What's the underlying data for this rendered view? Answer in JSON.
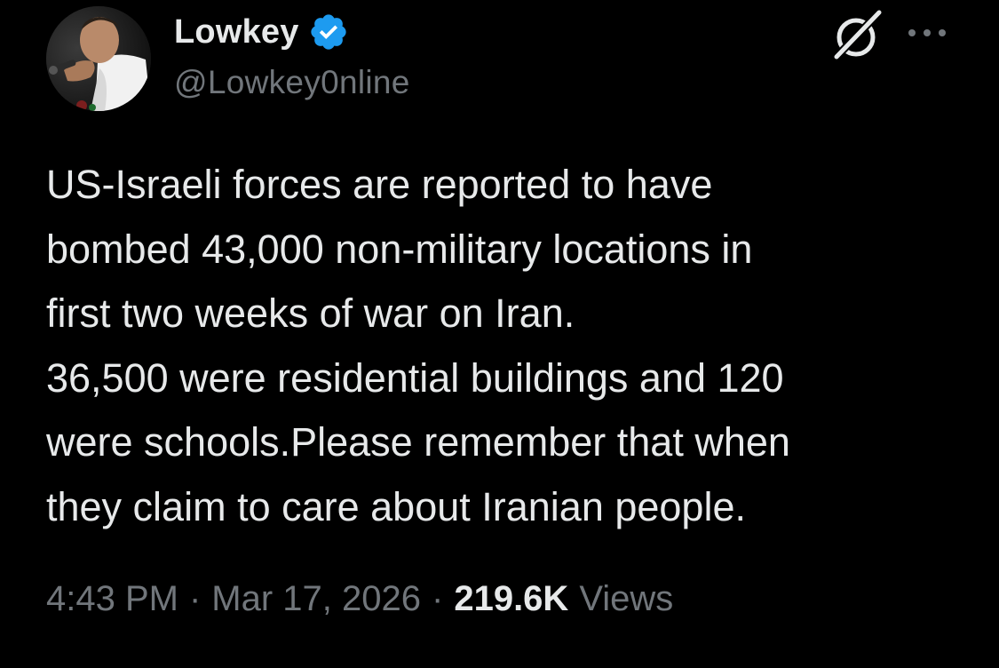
{
  "author": {
    "display_name": "Lowkey",
    "handle": "@Lowkey0nline",
    "verified": true,
    "verified_color": "#1d9bf0",
    "avatar_icon": "avatar-photo"
  },
  "header_actions": {
    "grok_icon": "grok-icon",
    "more_icon": "more-icon"
  },
  "tweet": {
    "lines": [
      "US-Israeli forces are reported to have",
      "bombed 43,000 non-military locations in",
      "first two weeks of war on Iran.",
      "36,500 were residential buildings and 120",
      "were schools.Please remember that when",
      "they claim to care about Iranian people."
    ]
  },
  "meta": {
    "time": "4:43 PM",
    "separator": "·",
    "date": "Mar 17, 2026",
    "views_count": "219.6K",
    "views_label": "Views"
  },
  "colors": {
    "background": "#000000",
    "primary_text": "#e7e9ea",
    "secondary_text": "#71767b"
  }
}
